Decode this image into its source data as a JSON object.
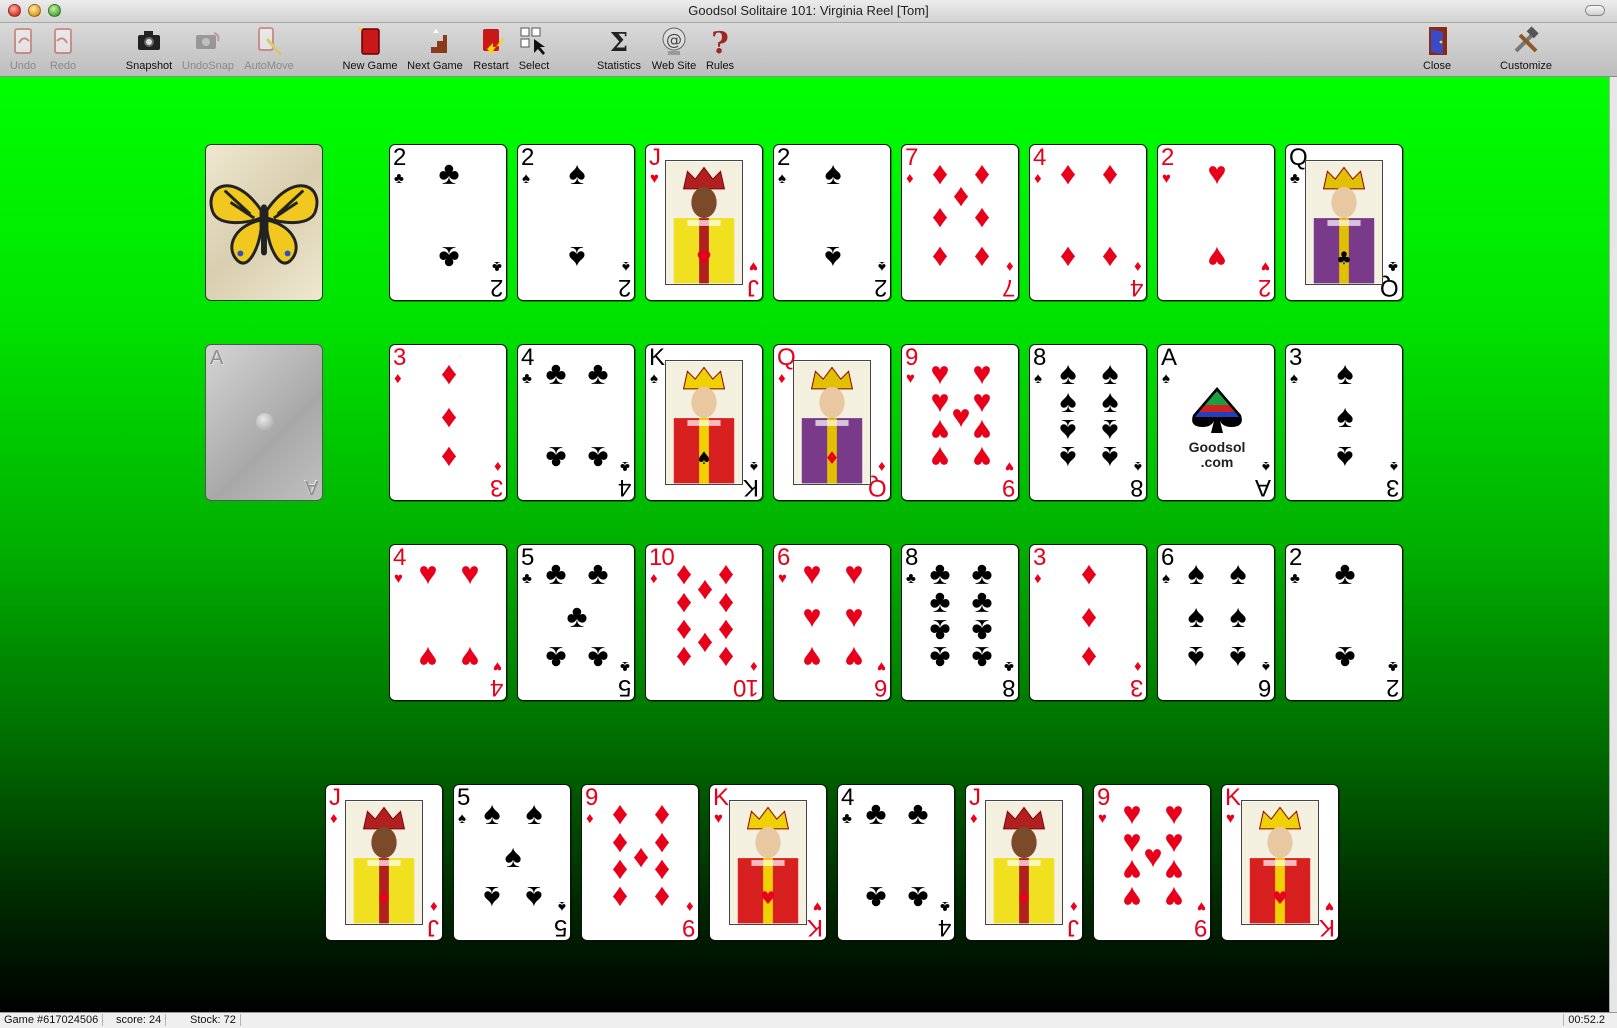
{
  "window": {
    "title": "Goodsol Solitaire 101: Virginia Reel [Tom]"
  },
  "toolbar": [
    {
      "id": "undo",
      "label": "Undo",
      "enabled": false,
      "icon": "undo-card-icon"
    },
    {
      "id": "redo",
      "label": "Redo",
      "enabled": false,
      "icon": "redo-card-icon"
    },
    {
      "id": "snapshot",
      "label": "Snapshot",
      "enabled": true,
      "icon": "camera-icon"
    },
    {
      "id": "undosnap",
      "label": "UndoSnap",
      "enabled": false,
      "icon": "camera-undo-icon"
    },
    {
      "id": "automove",
      "label": "AutoMove",
      "enabled": false,
      "icon": "automove-wand-icon"
    },
    {
      "id": "newgame",
      "label": "New Game",
      "enabled": true,
      "icon": "new-game-card-icon"
    },
    {
      "id": "nextgame",
      "label": "Next Game",
      "enabled": true,
      "icon": "stairs-icon"
    },
    {
      "id": "restart",
      "label": "Restart",
      "enabled": true,
      "icon": "restart-arrow-icon"
    },
    {
      "id": "select",
      "label": "Select",
      "enabled": true,
      "icon": "select-grid-icon"
    },
    {
      "id": "statistics",
      "label": "Statistics",
      "enabled": true,
      "icon": "sigma-icon"
    },
    {
      "id": "website",
      "label": "Web Site",
      "enabled": true,
      "icon": "web-at-icon"
    },
    {
      "id": "rules",
      "label": "Rules",
      "enabled": true,
      "icon": "question-mark-icon"
    },
    {
      "id": "close",
      "label": "Close",
      "enabled": true,
      "icon": "door-icon"
    },
    {
      "id": "customize",
      "label": "Customize",
      "enabled": true,
      "icon": "tools-icon"
    }
  ],
  "colors": {
    "felt_top": "#00ff00",
    "felt_bottom": "#000000",
    "red_suit": "#e8001a",
    "black_suit": "#000000"
  },
  "stock": {
    "icon": "butterfly-card-back"
  },
  "waste": {
    "ghost_rank": "A"
  },
  "tableau": [
    [
      {
        "r": "2",
        "s": "clubs"
      },
      {
        "r": "2",
        "s": "spades"
      },
      {
        "r": "J",
        "s": "hearts"
      },
      {
        "r": "2",
        "s": "spades"
      },
      {
        "r": "7",
        "s": "diamonds"
      },
      {
        "r": "4",
        "s": "diamonds"
      },
      {
        "r": "2",
        "s": "hearts"
      },
      {
        "r": "Q",
        "s": "clubs"
      }
    ],
    [
      {
        "r": "3",
        "s": "diamonds"
      },
      {
        "r": "4",
        "s": "clubs"
      },
      {
        "r": "K",
        "s": "spades"
      },
      {
        "r": "Q",
        "s": "diamonds"
      },
      {
        "r": "9",
        "s": "hearts"
      },
      {
        "r": "8",
        "s": "spades"
      },
      {
        "r": "A",
        "s": "spades",
        "logo": "Goodsol .com"
      },
      {
        "r": "3",
        "s": "spades"
      }
    ],
    [
      {
        "r": "4",
        "s": "hearts"
      },
      {
        "r": "5",
        "s": "clubs"
      },
      {
        "r": "10",
        "s": "diamonds"
      },
      {
        "r": "6",
        "s": "hearts"
      },
      {
        "r": "8",
        "s": "clubs"
      },
      {
        "r": "3",
        "s": "diamonds"
      },
      {
        "r": "6",
        "s": "spades"
      },
      {
        "r": "2",
        "s": "clubs"
      }
    ]
  ],
  "reserve": [
    {
      "r": "J",
      "s": "diamonds"
    },
    {
      "r": "5",
      "s": "spades"
    },
    {
      "r": "9",
      "s": "diamonds"
    },
    {
      "r": "K",
      "s": "hearts"
    },
    {
      "r": "4",
      "s": "clubs"
    },
    {
      "r": "J",
      "s": "diamonds"
    },
    {
      "r": "9",
      "s": "hearts"
    },
    {
      "r": "K",
      "s": "hearts"
    }
  ],
  "status": {
    "game": "Game #617024506",
    "score": "score: 24",
    "stock": "Stock: 72",
    "time": "00:52.2"
  }
}
